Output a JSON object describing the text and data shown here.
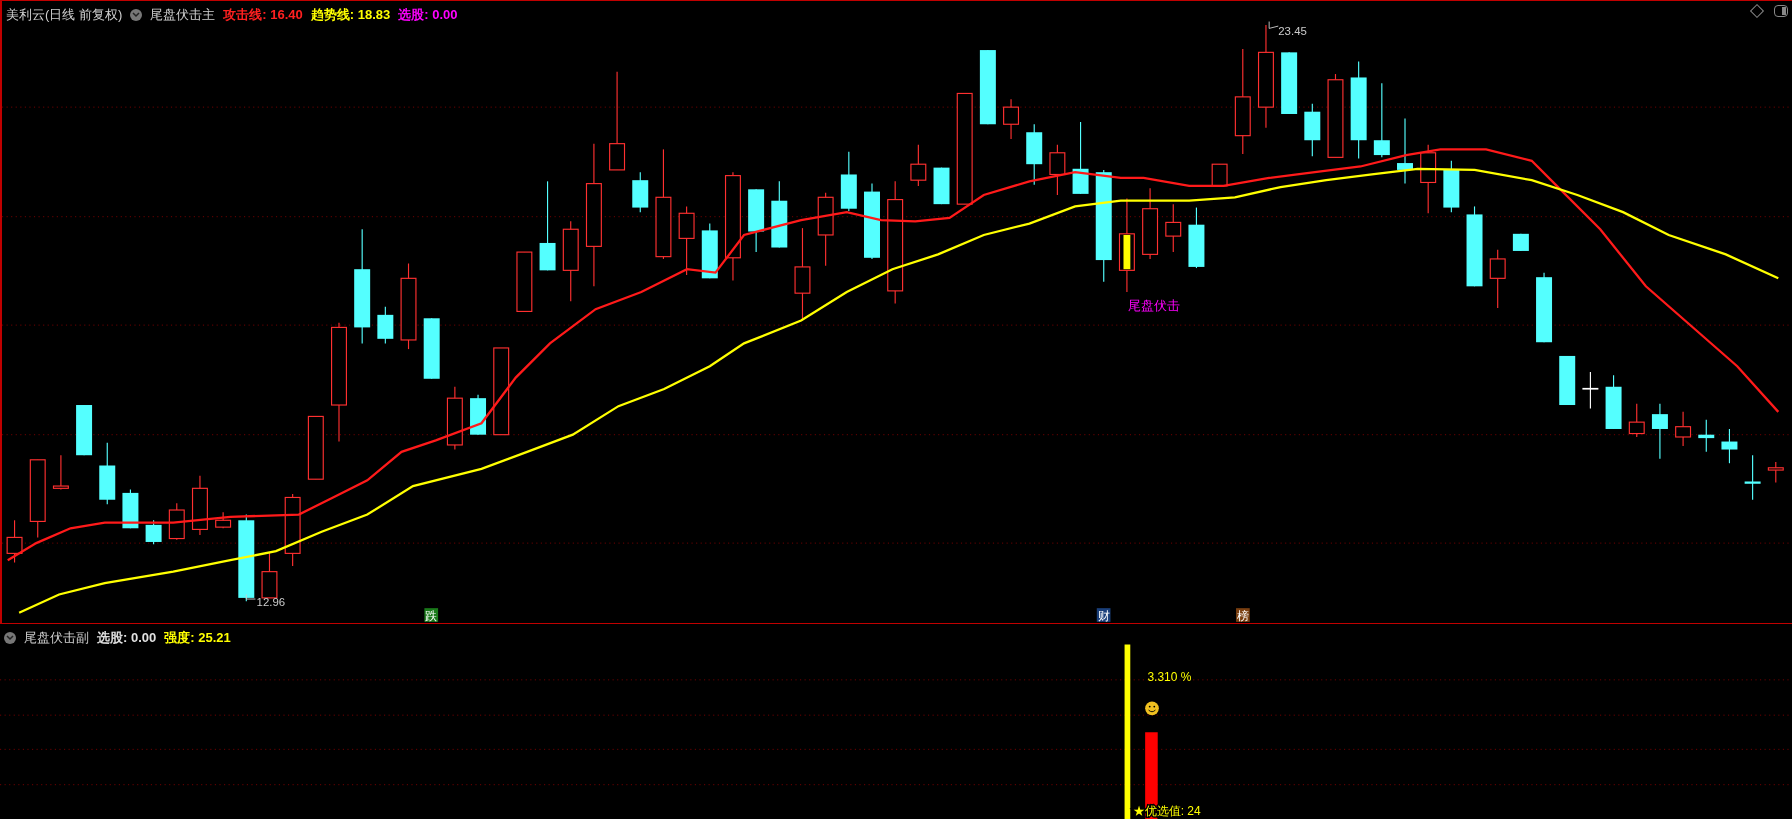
{
  "main_panel": {
    "symbol": "美利云(日线 前复权)",
    "indicator": "尾盘伏击主",
    "readouts": [
      {
        "label": "攻击线:",
        "value": "16.40",
        "color": "#ff2020"
      },
      {
        "label": "趋势线:",
        "value": "18.83",
        "color": "#ffff00"
      },
      {
        "label": "选股:",
        "value": "0.00",
        "color": "#ff00ff"
      }
    ]
  },
  "price_labels": [
    {
      "kind": "high",
      "text": "23.45"
    },
    {
      "kind": "low",
      "text": "12.96"
    }
  ],
  "signal_label": "尾盘伏击",
  "markers": [
    {
      "text": "跌",
      "color": "#1a7a1a"
    },
    {
      "text": "财",
      "color": "#1a3f7a"
    },
    {
      "text": "榜",
      "color": "#7a3f10"
    }
  ],
  "sub_panel": {
    "indicator": "尾盘伏击副",
    "readouts": [
      {
        "label": "选股:",
        "value": "0.00",
        "color": "#e0e0e0"
      },
      {
        "label": "强度:",
        "value": "25.21",
        "color": "#ffff00"
      }
    ]
  },
  "percent_label": "3.310 %",
  "best_value": {
    "label": "★优选值:",
    "value": "24"
  }
}
